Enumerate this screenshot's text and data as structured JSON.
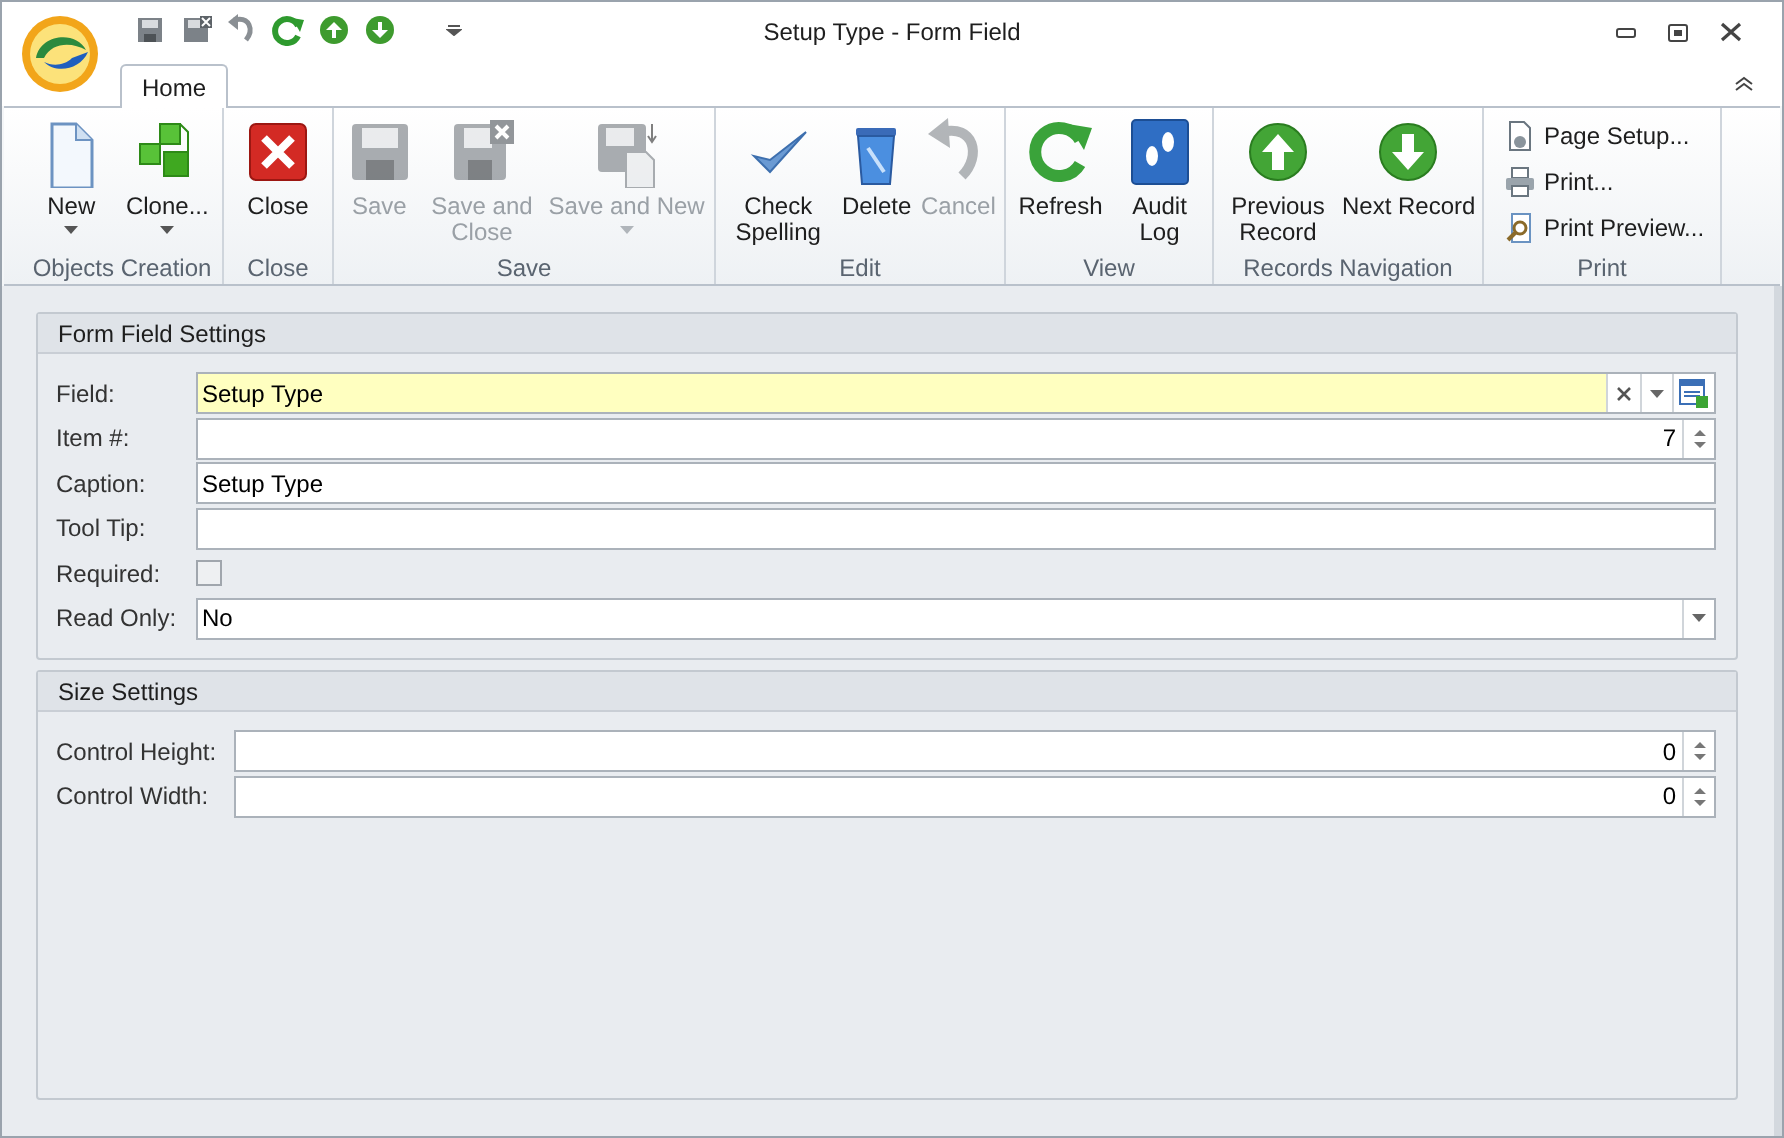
{
  "window": {
    "title": "Setup Type - Form Field"
  },
  "tabs": [
    {
      "label": "Home",
      "selected": true
    }
  ],
  "ribbon": {
    "groups": [
      {
        "label": "Objects Creation",
        "buttons": [
          {
            "label": "New",
            "disabled": false,
            "dropdown": true
          },
          {
            "label": "Clone...",
            "disabled": false,
            "dropdown": true
          }
        ]
      },
      {
        "label": "Close",
        "buttons": [
          {
            "label": "Close",
            "disabled": false,
            "dropdown": false
          }
        ]
      },
      {
        "label": "Save",
        "buttons": [
          {
            "label": "Save",
            "disabled": true,
            "dropdown": false
          },
          {
            "label": "Save and Close",
            "disabled": true,
            "dropdown": false
          },
          {
            "label": "Save and New",
            "disabled": true,
            "dropdown": true
          }
        ]
      },
      {
        "label": "Edit",
        "buttons": [
          {
            "label": "Check Spelling",
            "disabled": false,
            "dropdown": false
          },
          {
            "label": "Delete",
            "disabled": false,
            "dropdown": false
          },
          {
            "label": "Cancel",
            "disabled": true,
            "dropdown": false
          }
        ]
      },
      {
        "label": "View",
        "buttons": [
          {
            "label": "Refresh",
            "disabled": false,
            "dropdown": false
          },
          {
            "label": "Audit Log",
            "disabled": false,
            "dropdown": false
          }
        ]
      },
      {
        "label": "Records Navigation",
        "buttons": [
          {
            "label": "Previous Record",
            "disabled": false,
            "dropdown": false
          },
          {
            "label": "Next Record",
            "disabled": false,
            "dropdown": false
          }
        ]
      },
      {
        "label": "Print",
        "small": true,
        "buttons": [
          {
            "label": "Page Setup...",
            "disabled": false
          },
          {
            "label": "Print...",
            "disabled": false
          },
          {
            "label": "Print Preview...",
            "disabled": false
          }
        ]
      }
    ]
  },
  "sections": [
    {
      "title": "Form Field Settings",
      "fields": [
        {
          "label": "Field:",
          "kind": "lookup",
          "value": "Setup Type",
          "highlighted": true
        },
        {
          "label": "Item #:",
          "kind": "spin",
          "value": "7"
        },
        {
          "label": "Caption:",
          "kind": "text",
          "value": "Setup Type"
        },
        {
          "label": "Tool Tip:",
          "kind": "text"
        },
        {
          "label": "Required:",
          "kind": "checkbox",
          "checked": false
        },
        {
          "label": "Read Only:",
          "kind": "combo",
          "value": "No"
        }
      ]
    },
    {
      "title": "Size Settings",
      "fields": [
        {
          "label": "Control Height:",
          "kind": "spin",
          "value": "0"
        },
        {
          "label": "Control Width:",
          "kind": "spin",
          "value": "0"
        }
      ]
    }
  ]
}
